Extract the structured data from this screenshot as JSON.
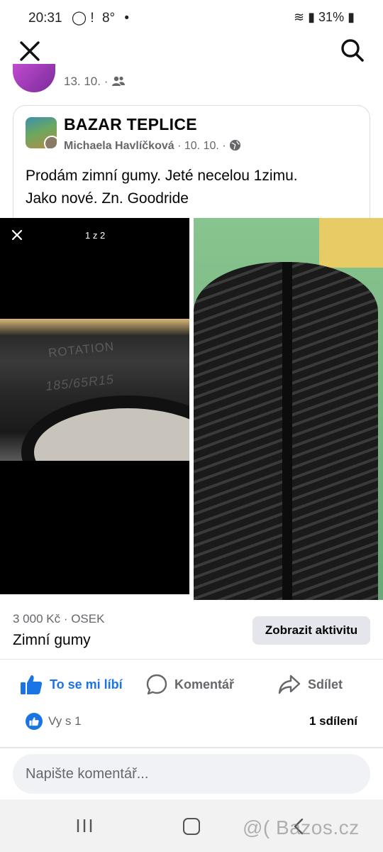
{
  "status_bar": {
    "time": "20:31",
    "temp": "8°",
    "battery": "31%"
  },
  "previous_post": {
    "date": "13. 10."
  },
  "shared_post": {
    "group_name": "BAZAR TEPLICE",
    "author": "Michaela Havlíčková",
    "date": "10. 10.",
    "text_line1": "Prodám zimní gumy. Jeté necelou 1zimu.",
    "text_line2": "Jako nové.  Zn. Goodride",
    "photo_counter": "1 z 2",
    "photo_text_rotation": "ROTATION",
    "photo_text_size": "185/65R15"
  },
  "listing": {
    "price_location": "3 000 Kč · OSEK",
    "title": "Zimní gumy",
    "activity_button": "Zobrazit aktivitu"
  },
  "actions": {
    "like": "To se mi líbí",
    "comment": "Komentář",
    "share": "Sdílet"
  },
  "reactions": {
    "likes": "Vy s 1",
    "shares": "1 sdílení"
  },
  "comment": {
    "placeholder": "Napište komentář..."
  },
  "watermark": "@( Bazos.cz",
  "colors": {
    "accent": "#1b74e4",
    "secondary_text": "#65676b",
    "input_bg": "#f0f2f5"
  }
}
